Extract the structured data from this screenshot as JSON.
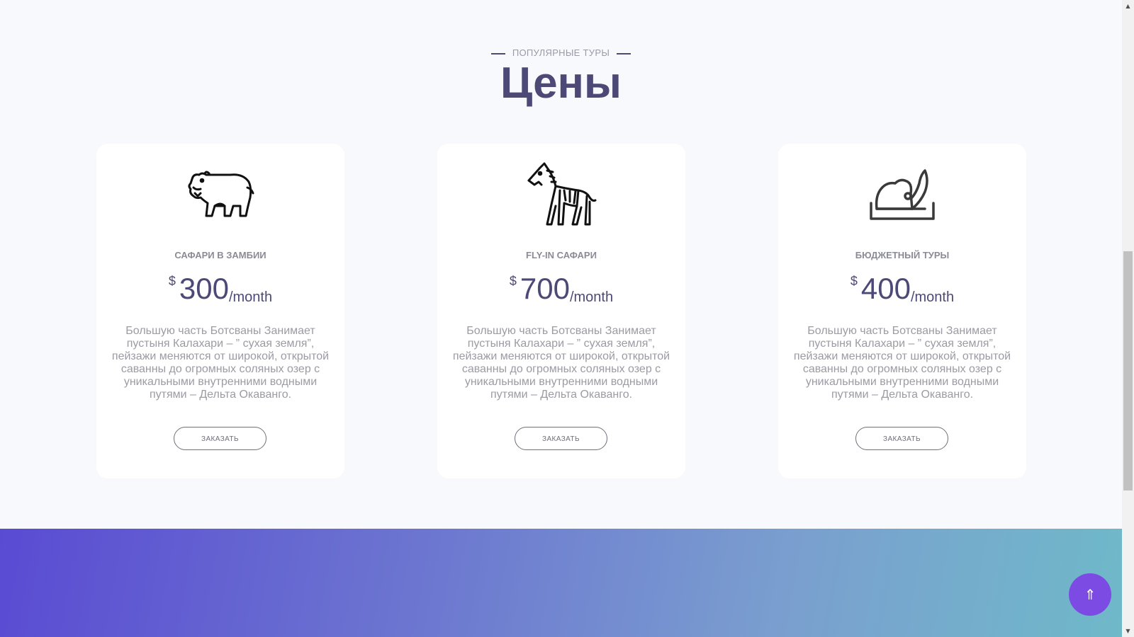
{
  "section": {
    "subtitle": "ПОПУЛЯРНЫЕ ТУРЫ",
    "title": "Цены"
  },
  "cards": [
    {
      "icon": "hippo-icon",
      "title": "САФАРИ В ЗАМБИИ",
      "currency": "$",
      "amount": "300",
      "period": "/month",
      "description": "Большую часть Ботсваны Занимает пустыня Калахари – ” сухая земля”, пейзажи меняются от широкой, открытой саванны до огромных соляных озер с уникальными внутренними водными путями – Дельта Окаванго.",
      "button": "ЗАКАЗАТЬ"
    },
    {
      "icon": "zebra-icon",
      "title": "FLY-IN САФАРИ",
      "currency": "$",
      "amount": "700",
      "period": "/month",
      "description": "Большую часть Ботсваны Занимает пустыня Калахари – ” сухая земля”, пейзажи меняются от широкой, открытой саванны до огромных соляных озер с уникальными внутренними водными путями – Дельта Окаванго.",
      "button": "ЗАКАЗАТЬ"
    },
    {
      "icon": "safari-hat-icon",
      "title": "БЮДЖЕТНЫЙ ТУРЫ",
      "currency": "$",
      "amount": "400",
      "period": "/month",
      "description": "Большую часть Ботсваны Занимает пустыня Калахари – ” сухая земля”, пейзажи меняются от широкой, открытой саванны до огромных соляных озер с уникальными внутренними водными путями – Дельта Окаванго.",
      "button": "ЗАКАЗАТЬ"
    }
  ],
  "scroll_top": {
    "icon": "double-arrow-up-icon",
    "glyph": "⇑"
  },
  "colors": {
    "accent": "#4c4976",
    "scroll_button": "#7c4be3",
    "gradient_start": "#5a4bd3",
    "gradient_end": "#6fb9c9"
  }
}
